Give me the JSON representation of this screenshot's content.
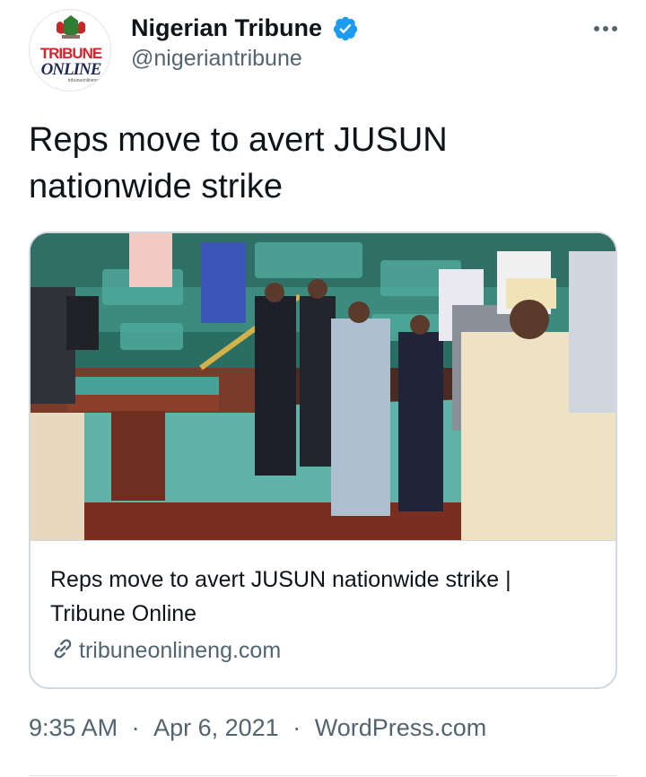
{
  "tweet": {
    "author": {
      "display_name": "Nigerian Tribune",
      "handle": "@nigeriantribune",
      "verified": true,
      "avatar_logo": {
        "line1": "TRIBUNE",
        "line2": "ONLINE",
        "tagline": "tribuneonlineng"
      }
    },
    "text": "Reps move to avert JUSUN nationwide strike",
    "card": {
      "title": "Reps move to avert JUSUN nationwide strike | Tribune Online",
      "domain": "tribuneonlineng.com"
    },
    "meta": {
      "time": "9:35 AM",
      "separator": "·",
      "date": "Apr 6, 2021",
      "source": "WordPress.com"
    }
  },
  "icons": {
    "verified": "verified-badge-icon",
    "more": "more-icon",
    "link": "link-icon"
  },
  "colors": {
    "verified_blue": "#1d9bf0",
    "secondary_text": "#536471",
    "border": "#cfd9de",
    "logo_red": "#d8232a",
    "logo_navy": "#1f2a5a"
  }
}
